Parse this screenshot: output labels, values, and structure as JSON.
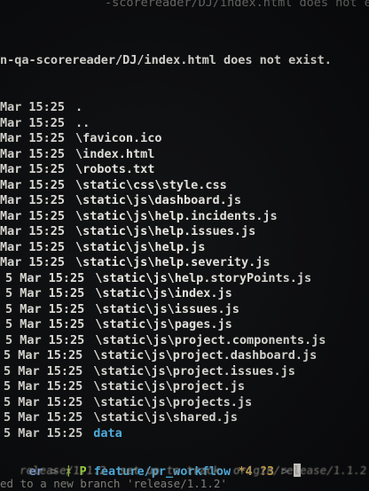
{
  "terminal": {
    "top_error_1": "-scorereader/DJ/index.html does not exist.",
    "top_error_2": "n-qa-scorereader/DJ/index.html does not exist.",
    "listing": [
      {
        "date": "Mar",
        "time": "15:25",
        "path": "."
      },
      {
        "date": "Mar",
        "time": "15:25",
        "path": ".."
      },
      {
        "date": "Mar",
        "time": "15:25",
        "path": "\\favicon.ico"
      },
      {
        "date": "Mar",
        "time": "15:25",
        "path": "\\index.html"
      },
      {
        "date": "Mar",
        "time": "15:25",
        "path": "\\robots.txt"
      },
      {
        "date": "Mar",
        "time": "15:25",
        "path": "\\static\\css\\style.css"
      },
      {
        "date": "Mar",
        "time": "15:25",
        "path": "\\static\\js\\dashboard.js"
      },
      {
        "date": "Mar",
        "time": "15:25",
        "path": "\\static\\js\\help.incidents.js"
      },
      {
        "date": "Mar",
        "time": "15:25",
        "path": "\\static\\js\\help.issues.js"
      },
      {
        "date": "Mar",
        "time": "15:25",
        "path": "\\static\\js\\help.js"
      },
      {
        "date": "Mar",
        "time": "15:25",
        "path": "\\static\\js\\help.severity.js"
      },
      {
        "date": "Mar",
        "time": "15:25",
        "path": "\\static\\js\\help.storyPoints.js"
      },
      {
        "date": "Mar",
        "time": "15:25",
        "path": "\\static\\js\\index.js"
      },
      {
        "date": "Mar",
        "time": "15:25",
        "path": "\\static\\js\\issues.js"
      },
      {
        "date": "Mar",
        "time": "15:25",
        "path": "\\static\\js\\pages.js"
      },
      {
        "date": "Mar",
        "time": "15:25",
        "path": "\\static\\js\\project.components.js"
      },
      {
        "date": "Mar",
        "time": "15:25",
        "path": "\\static\\js\\project.dashboard.js"
      },
      {
        "date": "Mar",
        "time": "15:25",
        "path": "\\static\\js\\project.issues.js"
      },
      {
        "date": "Mar",
        "time": "15:25",
        "path": "\\static\\js\\project.js"
      },
      {
        "date": "Mar",
        "time": "15:25",
        "path": "\\static\\js\\projects.js"
      },
      {
        "date": "Mar",
        "time": "15:25",
        "path": "\\static\\js\\shared.js"
      },
      {
        "date": "Mar",
        "time": "15:25",
        "path": "data"
      }
    ],
    "listing_prefixes": [
      "",
      "",
      "",
      "",
      "",
      "",
      "",
      "",
      "",
      "",
      "",
      "5",
      "5",
      "5",
      "5",
      "5",
      "5",
      "5",
      "5",
      "5",
      "5",
      "5"
    ],
    "listing_day": [
      "",
      "",
      "",
      "",
      "",
      "",
      "",
      "",
      "",
      "",
      "",
      "",
      "",
      "",
      "",
      "",
      "",
      "",
      "",
      "",
      "",
      ""
    ],
    "prompt": {
      "user": "er",
      "separator": ">",
      "branch_icon": "P",
      "branch": "feature/pr_workflow",
      "status": "*4 ?3",
      "arrow": ">"
    },
    "git_line_1": "release/1.1.2  set up to track  origin/release/1.1.2 .",
    "git_line_2": "ed to a new branch 'release/1.1.2'"
  },
  "colors": {
    "background": "#0b0c0e",
    "text": "#f0eee8",
    "prompt_user": "#8fb7ff",
    "branch_icon": "#b6f24b",
    "branch": "#58c7ff",
    "status": "#f1c050",
    "dim_text": "#9a9892"
  }
}
